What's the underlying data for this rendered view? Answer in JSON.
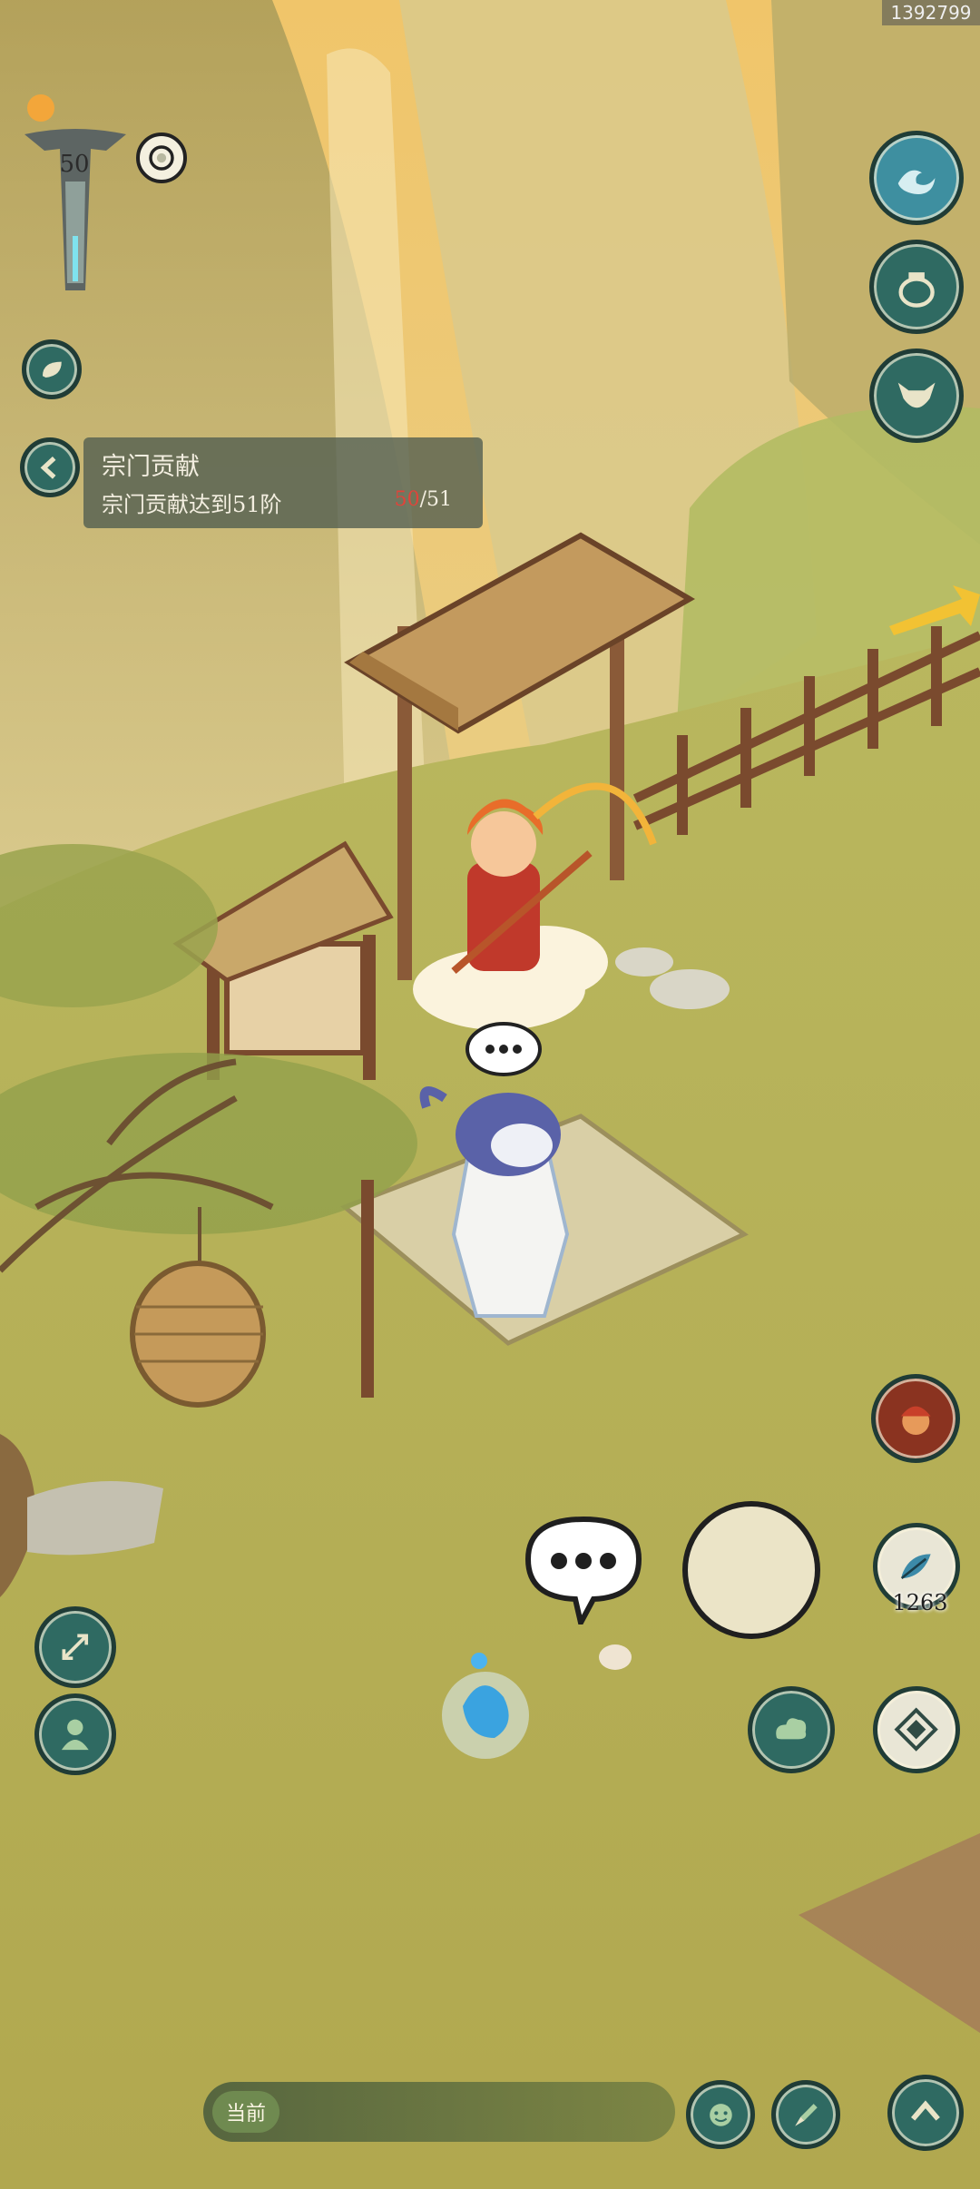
{
  "uid_text": "1392799",
  "hud": {
    "level": "50"
  },
  "quest": {
    "title": "宗门贡献",
    "description": "宗门贡献达到51阶",
    "progress_current": "50",
    "progress_total": "/51"
  },
  "resources": {
    "item_count": "1263"
  },
  "chat": {
    "current_channel_label": "当前"
  },
  "icons": {
    "right_top": [
      "water-wave-icon",
      "bag-icon",
      "ox-mask-icon"
    ],
    "right_bottom": [
      "monkey-portrait-icon",
      "feather-icon",
      "cloud-icon",
      "compass-icon",
      "up-arrow-icon"
    ],
    "left": [
      "collapse-arrow-icon",
      "leaf-icon",
      "fullscreen-icon",
      "character-icon"
    ],
    "chat": [
      "emoji-icon",
      "brush-icon"
    ]
  },
  "colors": {
    "hud_button": "#2f6a62",
    "grass": "#b9b25a",
    "progress_red": "#e0443a"
  }
}
